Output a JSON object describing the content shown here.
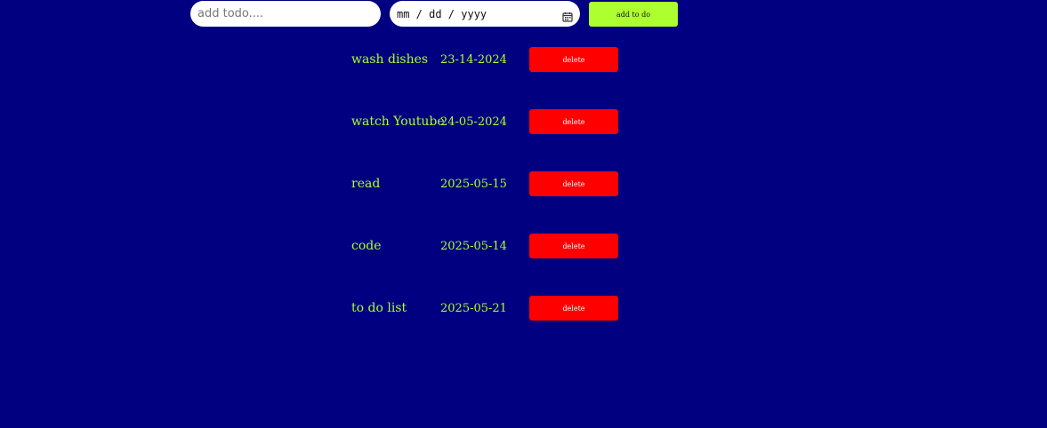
{
  "colors": {
    "background": "#000080",
    "accent": "#adff2f",
    "delete": "#ff0000",
    "text": "#adff2f"
  },
  "form": {
    "todo_placeholder": "add todo....",
    "date_placeholder": "mm / dd / yyyy",
    "date_icon": "calendar-icon",
    "add_label": "add to do"
  },
  "todos": [
    {
      "name": "wash dishes",
      "date": "23-14-2024",
      "delete_label": "delete"
    },
    {
      "name": "watch Youtube",
      "date": "24-05-2024",
      "delete_label": "delete"
    },
    {
      "name": "read",
      "date": "2025-05-15",
      "delete_label": "delete"
    },
    {
      "name": "code",
      "date": "2025-05-14",
      "delete_label": "delete"
    },
    {
      "name": "to do list",
      "date": "2025-05-21",
      "delete_label": "delete"
    }
  ]
}
